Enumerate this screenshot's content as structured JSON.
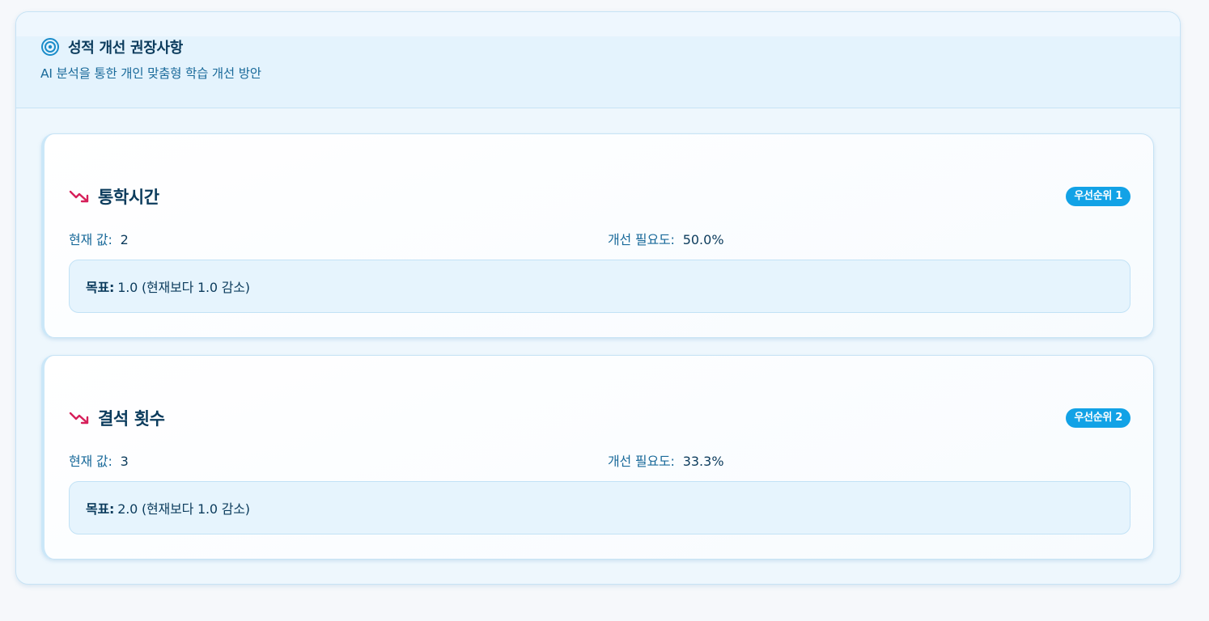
{
  "header": {
    "title": "성적 개선 권장사항",
    "subtitle": "AI 분석을 통한 개인 맞춤형 학습 개선 방안",
    "icon": "target-icon"
  },
  "colors": {
    "accent": "#12a2e6",
    "title_text": "#0b3b5c",
    "label_text": "#1a6a9a",
    "trend_down": "#d61f5a",
    "goal_bg": "#e6f4fd"
  },
  "recommendations": [
    {
      "icon": "trending-down-icon",
      "title": "통학시간",
      "priority": "우선순위 1",
      "current_label": "현재 값:",
      "current_value": "2",
      "need_label": "개선 필요도:",
      "need_value": "50.0%",
      "goal_label": "목표:",
      "goal_text": "1.0 (현재보다 1.0 감소)"
    },
    {
      "icon": "trending-down-icon",
      "title": "결석 횟수",
      "priority": "우선순위 2",
      "current_label": "현재 값:",
      "current_value": "3",
      "need_label": "개선 필요도:",
      "need_value": "33.3%",
      "goal_label": "목표:",
      "goal_text": "2.0 (현재보다 1.0 감소)"
    }
  ]
}
